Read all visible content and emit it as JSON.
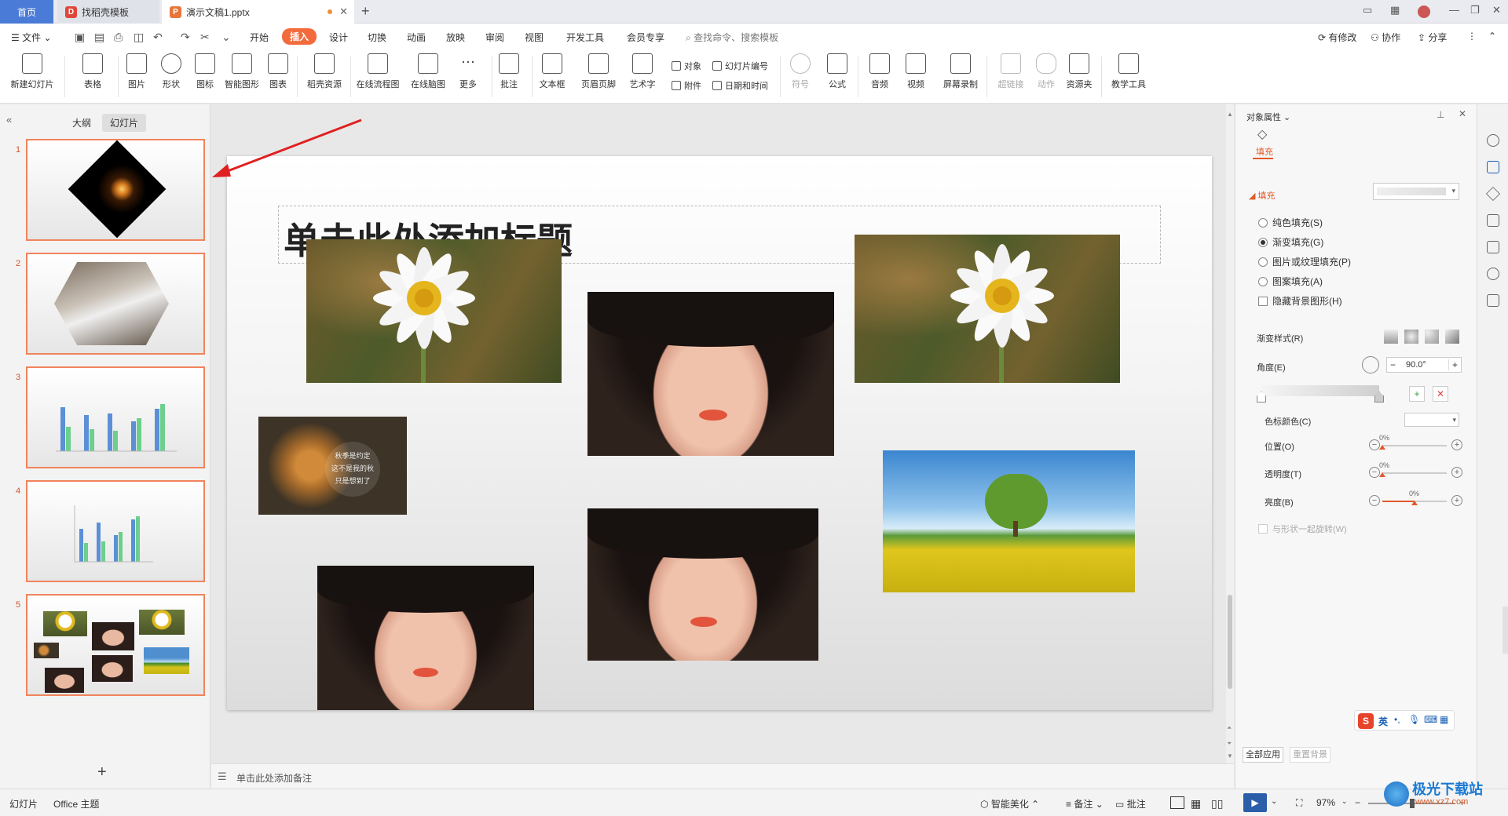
{
  "tabs": {
    "home": "首页",
    "template": "找稻壳模板",
    "doc": "演示文稿1.pptx"
  },
  "menu": {
    "file": "文件",
    "items": [
      "开始",
      "插入",
      "设计",
      "切换",
      "动画",
      "放映",
      "审阅",
      "视图",
      "开发工具",
      "会员专享"
    ],
    "active": "插入",
    "search": "查找命令、搜索模板",
    "right": [
      "有修改",
      "协作",
      "分享"
    ]
  },
  "ribbon": {
    "buttons": [
      "新建幻灯片",
      "表格",
      "图片",
      "形状",
      "图标",
      "智能图形",
      "图表",
      "稻壳资源",
      "在线流程图",
      "在线脑图",
      "更多",
      "批注",
      "文本框",
      "页眉页脚",
      "艺术字"
    ],
    "small": [
      "对象",
      "幻灯片编号",
      "附件",
      "日期和时间"
    ],
    "buttons2": [
      "符号",
      "公式",
      "音频",
      "视频",
      "屏幕录制",
      "超链接",
      "动作",
      "资源夹",
      "教学工具"
    ]
  },
  "left": {
    "tab_outline": "大纲",
    "tab_slides": "幻灯片",
    "slides": [
      "1",
      "2",
      "3",
      "4",
      "5"
    ],
    "add": "+"
  },
  "slide": {
    "title": "单击此处添加标题",
    "autumn_text": "秋季是约定\n这不是我的秋\n只是想到了"
  },
  "notes": {
    "placeholder": "单击此处添加备注"
  },
  "panel": {
    "title": "对象属性",
    "tab": "填充",
    "section": "填充",
    "options": [
      "纯色填充(S)",
      "渐变填充(G)",
      "图片或纹理填充(P)",
      "图案填充(A)"
    ],
    "selected": "渐变填充(G)",
    "hide_bg": "隐藏背景图形(H)",
    "grad_style": "渐变样式(R)",
    "angle_label": "角度(E)",
    "angle": "90.0°",
    "stop_color": "色标颜色(C)",
    "position_label": "位置(O)",
    "position": "0%",
    "transparency_label": "透明度(T)",
    "transparency": "0%",
    "brightness_label": "亮度(B)",
    "brightness": "0%",
    "rotate_with_shape": "与形状一起旋转(W)",
    "apply_all": "全部应用",
    "reset_bg": "重置背景"
  },
  "status": {
    "slide": "幻灯片",
    "theme": "Office 主题",
    "beautify": "智能美化",
    "notes": "备注",
    "comment": "批注",
    "zoom": "97%"
  },
  "ime": {
    "lang": "英"
  },
  "watermark": {
    "text": "极光下载站",
    "url": "www.xz7.com"
  },
  "colors": {
    "accent": "#f36b3c",
    "home_tab": "#4a7bd6",
    "thumb_border": "#f0845c"
  }
}
